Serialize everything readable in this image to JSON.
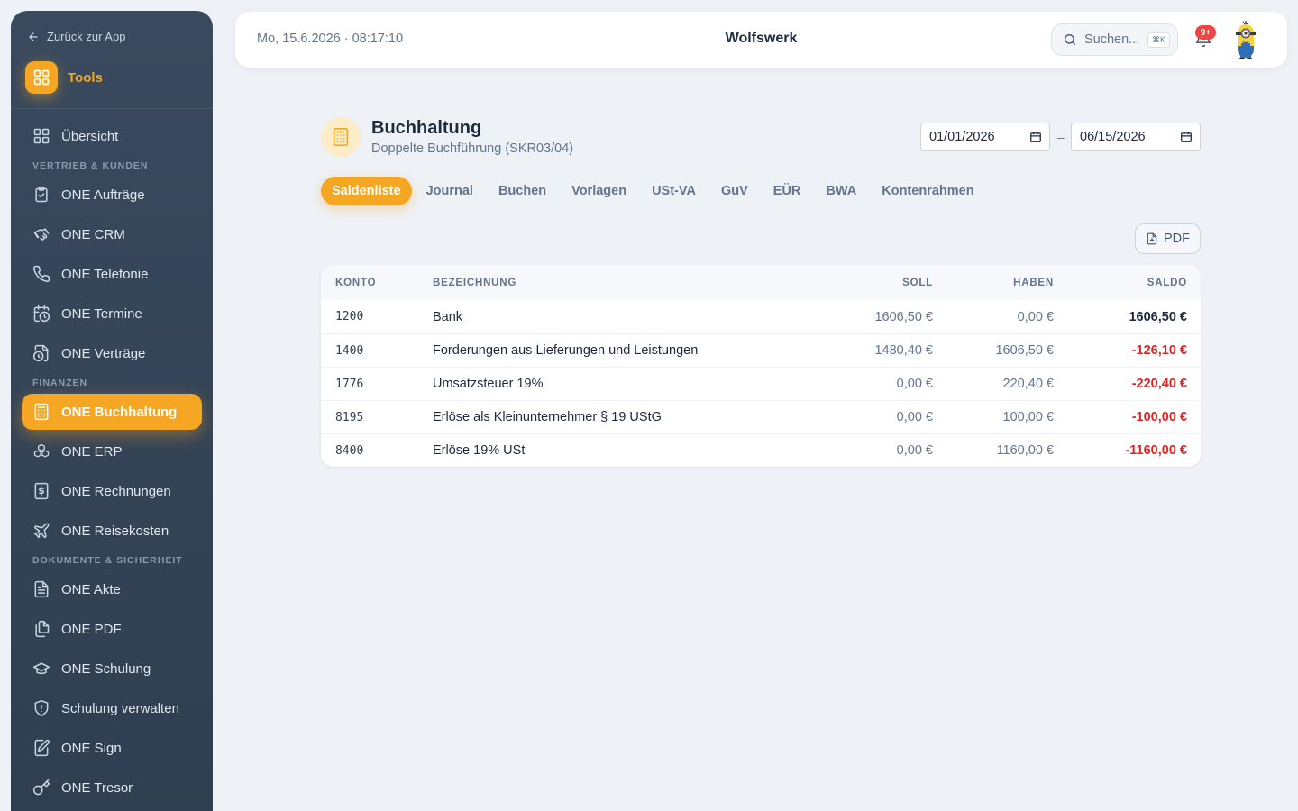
{
  "sidebar": {
    "back_label": "Zurück zur App",
    "tools_label": "Tools",
    "overview": "Übersicht",
    "sections": {
      "sales": "Vertrieb & Kunden",
      "finance": "Finanzen",
      "docs": "Dokumente & Sicherheit"
    },
    "items": {
      "auftraege": "ONE Aufträge",
      "crm": "ONE CRM",
      "telefonie": "ONE Telefonie",
      "termine": "ONE Termine",
      "vertraege": "ONE Verträge",
      "buchhaltung": "ONE Buchhaltung",
      "erp": "ONE ERP",
      "rechnungen": "ONE Rechnungen",
      "reisekosten": "ONE Reisekosten",
      "akte": "ONE Akte",
      "pdf": "ONE PDF",
      "schulung": "ONE Schulung",
      "schulung_verwalten": "Schulung verwalten",
      "sign": "ONE Sign",
      "tresor": "ONE Tresor"
    },
    "accent": "#f5a623"
  },
  "header": {
    "datetime": "Mo, 15.6.2026 · 08:17:10",
    "company": "Wolfswerk",
    "search_placeholder": "Suchen...",
    "search_shortcut": "⌘K",
    "notification_count": "9+"
  },
  "page": {
    "title": "Buchhaltung",
    "subtitle": "Doppelte Buchführung (SKR03/04)",
    "date_from": "01/01/2026",
    "date_to": "06/15/2026",
    "date_separator": "–",
    "pdf_label": "PDF"
  },
  "tabs": [
    "Saldenliste",
    "Journal",
    "Buchen",
    "Vorlagen",
    "USt-VA",
    "GuV",
    "EÜR",
    "BWA",
    "Kontenrahmen"
  ],
  "table": {
    "headers": {
      "konto": "Konto",
      "bezeichnung": "Bezeichnung",
      "soll": "Soll",
      "haben": "Haben",
      "saldo": "Saldo"
    },
    "rows": [
      {
        "konto": "1200",
        "bezeichnung": "Bank",
        "soll": "1606,50 €",
        "haben": "0,00 €",
        "saldo": "1606,50 €"
      },
      {
        "konto": "1400",
        "bezeichnung": "Forderungen aus Lieferungen und Leistungen",
        "soll": "1480,40 €",
        "haben": "1606,50 €",
        "saldo": "-126,10 €"
      },
      {
        "konto": "1776",
        "bezeichnung": "Umsatzsteuer 19%",
        "soll": "0,00 €",
        "haben": "220,40 €",
        "saldo": "-220,40 €"
      },
      {
        "konto": "8195",
        "bezeichnung": "Erlöse als Kleinunternehmer § 19 UStG",
        "soll": "0,00 €",
        "haben": "100,00 €",
        "saldo": "-100,00 €"
      },
      {
        "konto": "8400",
        "bezeichnung": "Erlöse 19% USt",
        "soll": "0,00 €",
        "haben": "1160,00 €",
        "saldo": "-1160,00 €"
      }
    ]
  }
}
